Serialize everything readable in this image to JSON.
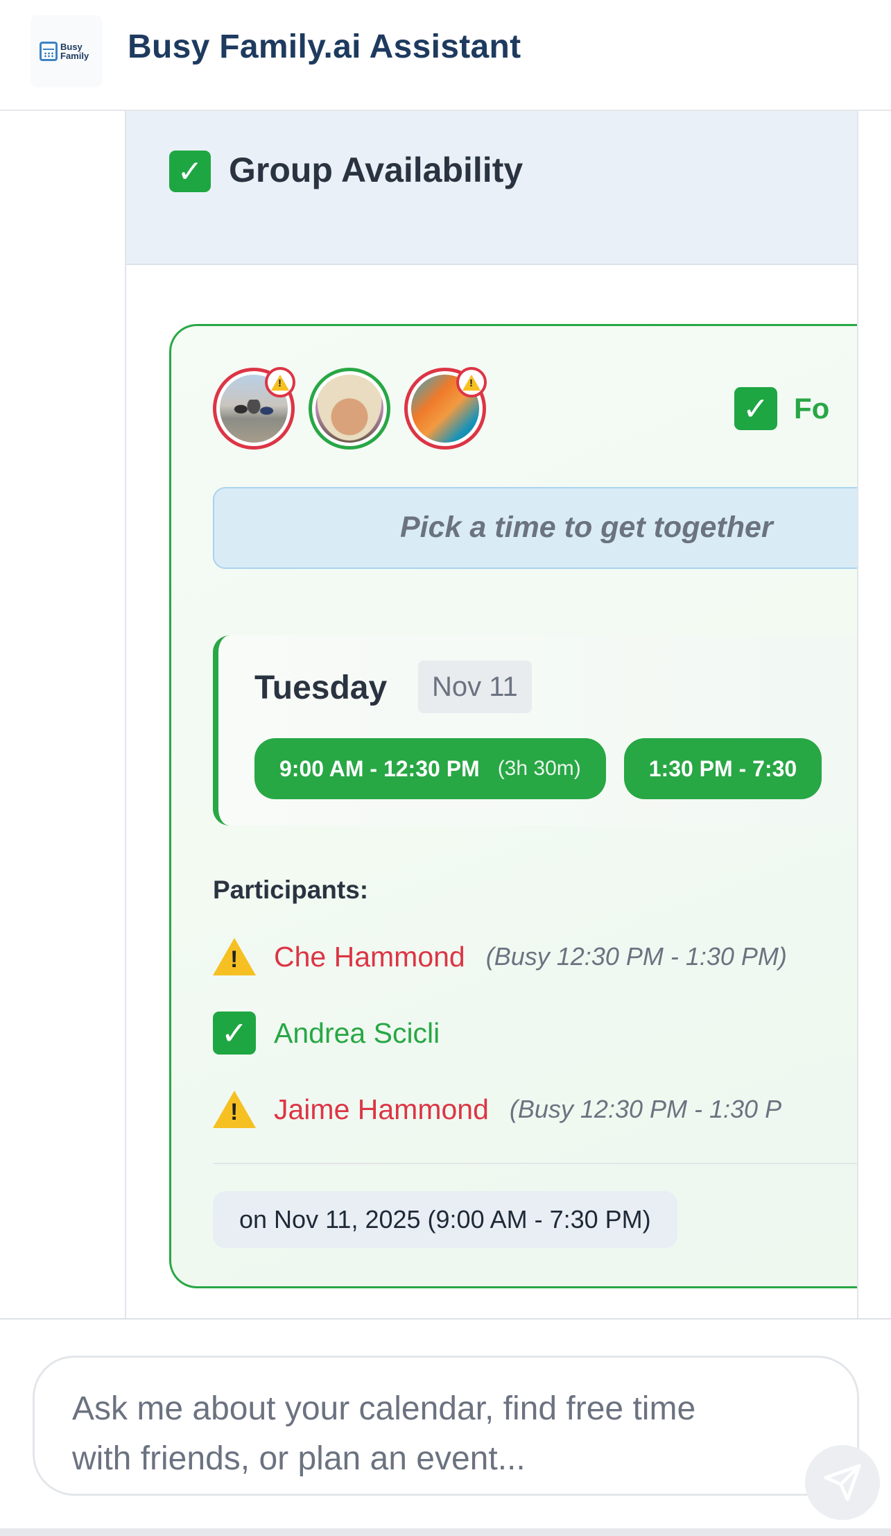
{
  "header": {
    "logo_text": "Busy Family",
    "title": "Busy Family.ai Assistant"
  },
  "card": {
    "title": "Group Availability",
    "title_icon": "check-mark-emoji"
  },
  "availability": {
    "found_label": "Fo",
    "pick_prompt": "Pick a time to get together",
    "avatars": [
      {
        "status": "busy",
        "badge": "warning-icon"
      },
      {
        "status": "free",
        "badge": ""
      },
      {
        "status": "busy",
        "badge": "warning-icon"
      }
    ],
    "day": {
      "name": "Tuesday",
      "date": "Nov 11",
      "slots": [
        {
          "time": "9:00 AM - 12:30 PM",
          "duration": "(3h 30m)"
        },
        {
          "time": "1:30 PM - 7:30",
          "duration": ""
        }
      ]
    },
    "participants_label": "Participants:",
    "participants": [
      {
        "name": "Che Hammond",
        "status": "busy",
        "note": "(Busy 12:30 PM - 1:30 PM)"
      },
      {
        "name": "Andrea Scicli",
        "status": "free",
        "note": ""
      },
      {
        "name": "Jaime Hammond",
        "status": "busy",
        "note": "(Busy 12:30 PM - 1:30 P"
      }
    ],
    "range": "on Nov 11, 2025 (9:00 AM - 7:30 PM)"
  },
  "composer": {
    "placeholder": "Ask me about your calendar, find free time with friends, or plan an event..."
  },
  "colors": {
    "brand": "#1e3a5f",
    "success": "#28a745",
    "danger": "#dc3545",
    "warning": "#f6c022"
  }
}
